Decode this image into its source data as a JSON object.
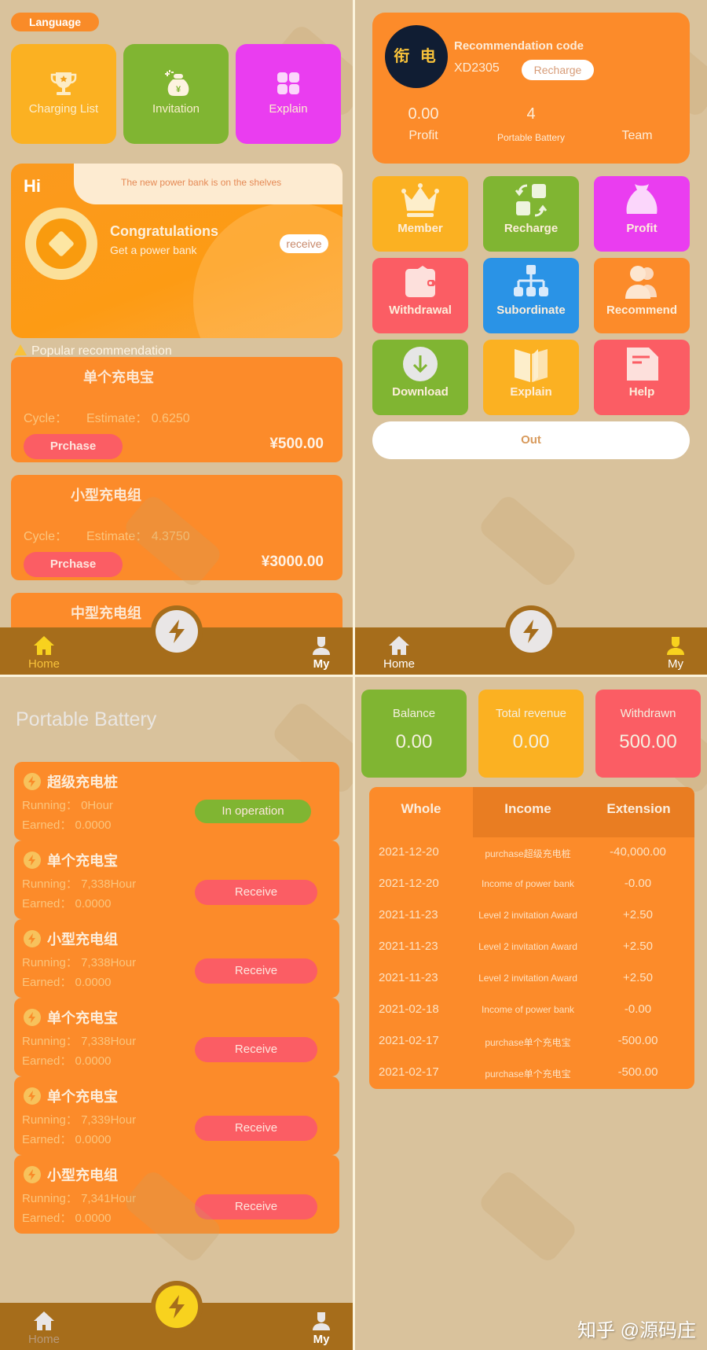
{
  "colors": {
    "background": "#d9c29c",
    "orange": "#fc8b2a",
    "yellow": "#fbb122",
    "green": "#80b532",
    "magenta": "#ea3df0",
    "red": "#fb5d64",
    "blue": "#2a93e6",
    "tabbar": "#a66d1b",
    "active_tab": "#f8d21e"
  },
  "home": {
    "language_label": "Language",
    "quick_tiles": [
      {
        "label": "Charging List",
        "icon": "trophy-icon",
        "color": "#fbb122"
      },
      {
        "label": "Invitation",
        "icon": "money-bag-icon",
        "color": "#80b532"
      },
      {
        "label": "Explain",
        "icon": "grid-icon",
        "color": "#ea3df0"
      }
    ],
    "banner": {
      "greeting": "Hi",
      "notice": "The new power bank is on the shelves",
      "title": "Congratulations",
      "subtitle": "Get a power bank",
      "receive_label": "receive"
    },
    "popular_label": "Popular recommendation",
    "products": [
      {
        "name": "单个充电宝",
        "cycle_label": "Cycle：",
        "estimate_label": "Estimate：",
        "estimate": "0.6250",
        "button": "Prchase",
        "price": "¥500.00"
      },
      {
        "name": "小型充电组",
        "cycle_label": "Cycle：",
        "estimate_label": "Estimate：",
        "estimate": "4.3750",
        "button": "Prchase",
        "price": "¥3000.00"
      },
      {
        "name": "中型充电组"
      }
    ]
  },
  "my": {
    "avatar_text": "衔 电",
    "recommendation_label": "Recommendation code",
    "code": "XD2305",
    "recharge_button": "Recharge",
    "stats": [
      {
        "value": "0.00",
        "label": "Profit"
      },
      {
        "value": "4",
        "label": "Portable Battery"
      },
      {
        "value": "",
        "label": "Team"
      }
    ],
    "menu": [
      {
        "label": "Member",
        "icon": "crown-icon",
        "color": "#fbb122"
      },
      {
        "label": "Recharge",
        "icon": "exchange-icon",
        "color": "#80b532"
      },
      {
        "label": "Profit",
        "icon": "money-bag-icon",
        "color": "#ea3df0"
      },
      {
        "label": "Withdrawal",
        "icon": "wallet-icon",
        "color": "#fb5d64"
      },
      {
        "label": "Subordinate",
        "icon": "hierarchy-icon",
        "color": "#2a93e6"
      },
      {
        "label": "Recommend",
        "icon": "users-icon",
        "color": "#fc8b2a"
      },
      {
        "label": "Download",
        "icon": "download-icon",
        "color": "#80b532"
      },
      {
        "label": "Explain",
        "icon": "book-icon",
        "color": "#fbb122"
      },
      {
        "label": "Help",
        "icon": "document-icon",
        "color": "#fb5d64"
      }
    ],
    "out_button": "Out"
  },
  "portable_battery": {
    "title": "Portable Battery",
    "running_label": "Running：",
    "earned_label": "Earned：",
    "items": [
      {
        "name": "超级充电桩",
        "running": "0Hour",
        "earned": "0.0000",
        "action": "In operation",
        "status": "running"
      },
      {
        "name": "单个充电宝",
        "running": "7,338Hour",
        "earned": "0.0000",
        "action": "Receive",
        "status": "receivable"
      },
      {
        "name": "小型充电组",
        "running": "7,338Hour",
        "earned": "0.0000",
        "action": "Receive",
        "status": "receivable"
      },
      {
        "name": "单个充电宝",
        "running": "7,338Hour",
        "earned": "0.0000",
        "action": "Receive",
        "status": "receivable"
      },
      {
        "name": "单个充电宝",
        "running": "7,339Hour",
        "earned": "0.0000",
        "action": "Receive",
        "status": "receivable"
      },
      {
        "name": "小型充电组",
        "running": "7,341Hour",
        "earned": "0.0000",
        "action": "Receive",
        "status": "receivable"
      }
    ]
  },
  "finance": {
    "cards": [
      {
        "label": "Balance",
        "value": "0.00",
        "color": "#80b532"
      },
      {
        "label": "Total revenue",
        "value": "0.00",
        "color": "#fbb122"
      },
      {
        "label": "Withdrawn",
        "value": "500.00",
        "color": "#fb5d64"
      }
    ],
    "tabs": [
      "Whole",
      "Income",
      "Extension"
    ],
    "active_tab": "Whole",
    "records": [
      {
        "date": "2021-12-20",
        "memo": "purchase超级充电桩",
        "amount": "-40,000.00"
      },
      {
        "date": "2021-12-20",
        "memo": "Income of power bank",
        "amount": "-0.00"
      },
      {
        "date": "2021-11-23",
        "memo": "Level 2 invitation Award",
        "amount": "+2.50"
      },
      {
        "date": "2021-11-23",
        "memo": "Level 2 invitation Award",
        "amount": "+2.50"
      },
      {
        "date": "2021-11-23",
        "memo": "Level 2 invitation Award",
        "amount": "+2.50"
      },
      {
        "date": "2021-02-18",
        "memo": "Income of power bank",
        "amount": "-0.00"
      },
      {
        "date": "2021-02-17",
        "memo": "purchase单个充电宝",
        "amount": "-500.00"
      },
      {
        "date": "2021-02-17",
        "memo": "purchase单个充电宝",
        "amount": "-500.00"
      }
    ]
  },
  "nav": {
    "home": "Home",
    "my": "My"
  },
  "watermark": "知乎 @源码庄"
}
